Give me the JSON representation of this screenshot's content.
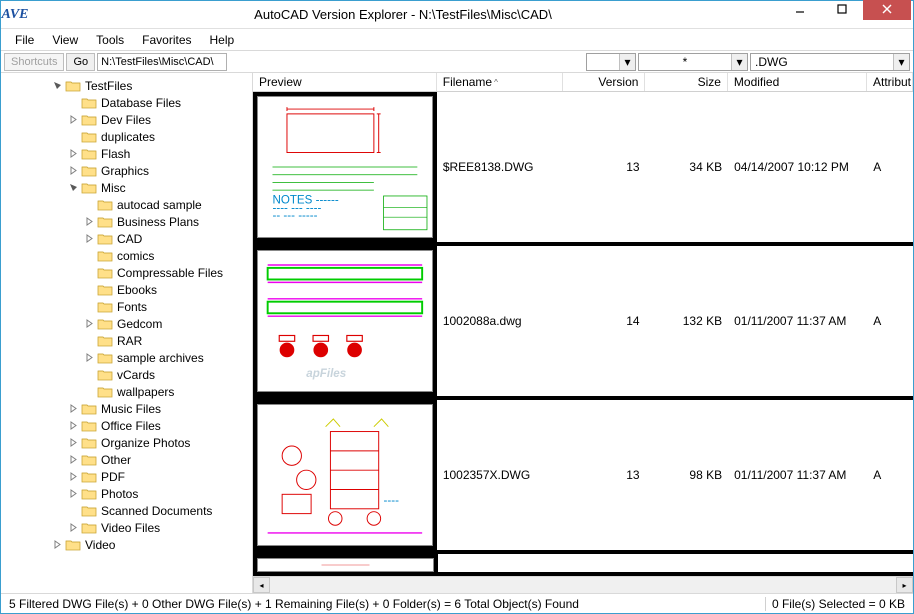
{
  "titlebar": {
    "logo_text": "AVE",
    "title": "AutoCAD Version Explorer - N:\\TestFiles\\Misc\\CAD\\"
  },
  "menu": [
    "File",
    "View",
    "Tools",
    "Favorites",
    "Help"
  ],
  "toolbar": {
    "shortcuts": "Shortcuts",
    "go": "Go",
    "path": "N:\\TestFiles\\Misc\\CAD\\",
    "filter1": "",
    "filter2": "*",
    "filter3": ".DWG"
  },
  "tree": [
    {
      "level": 3,
      "expand": "open",
      "label": "TestFiles"
    },
    {
      "level": 4,
      "expand": "none",
      "label": "Database Files"
    },
    {
      "level": 4,
      "expand": "closed",
      "label": "Dev Files"
    },
    {
      "level": 4,
      "expand": "none",
      "label": "duplicates"
    },
    {
      "level": 4,
      "expand": "closed",
      "label": "Flash"
    },
    {
      "level": 4,
      "expand": "closed",
      "label": "Graphics"
    },
    {
      "level": 4,
      "expand": "open",
      "label": "Misc"
    },
    {
      "level": 5,
      "expand": "none",
      "label": "autocad sample"
    },
    {
      "level": 5,
      "expand": "closed",
      "label": "Business Plans"
    },
    {
      "level": 5,
      "expand": "closed",
      "label": "CAD"
    },
    {
      "level": 5,
      "expand": "none",
      "label": "comics"
    },
    {
      "level": 5,
      "expand": "none",
      "label": "Compressable Files"
    },
    {
      "level": 5,
      "expand": "none",
      "label": "Ebooks"
    },
    {
      "level": 5,
      "expand": "none",
      "label": "Fonts"
    },
    {
      "level": 5,
      "expand": "closed",
      "label": "Gedcom"
    },
    {
      "level": 5,
      "expand": "none",
      "label": "RAR"
    },
    {
      "level": 5,
      "expand": "closed",
      "label": "sample archives"
    },
    {
      "level": 5,
      "expand": "none",
      "label": "vCards"
    },
    {
      "level": 5,
      "expand": "none",
      "label": "wallpapers"
    },
    {
      "level": 4,
      "expand": "closed",
      "label": "Music Files"
    },
    {
      "level": 4,
      "expand": "closed",
      "label": "Office Files"
    },
    {
      "level": 4,
      "expand": "closed",
      "label": "Organize Photos"
    },
    {
      "level": 4,
      "expand": "closed",
      "label": "Other"
    },
    {
      "level": 4,
      "expand": "closed",
      "label": "PDF"
    },
    {
      "level": 4,
      "expand": "closed",
      "label": "Photos"
    },
    {
      "level": 4,
      "expand": "none",
      "label": "Scanned Documents"
    },
    {
      "level": 4,
      "expand": "closed",
      "label": "Video Files"
    },
    {
      "level": 3,
      "expand": "closed",
      "label": "Video"
    }
  ],
  "columns": [
    {
      "label": "Preview",
      "width": 185,
      "align": "left"
    },
    {
      "label": "Filename",
      "width": 127,
      "align": "left",
      "sort": "^"
    },
    {
      "label": "Version",
      "width": 83,
      "align": "right"
    },
    {
      "label": "Size",
      "width": 83,
      "align": "right"
    },
    {
      "label": "Modified",
      "width": 140,
      "align": "left"
    },
    {
      "label": "Attribut",
      "width": 46,
      "align": "left"
    }
  ],
  "files": [
    {
      "filename": "$REE8138.DWG",
      "version": "13",
      "size": "34 KB",
      "modified": "04/14/2007 10:12 PM",
      "attr": "A",
      "preview": "cad1"
    },
    {
      "filename": "1002088a.dwg",
      "version": "14",
      "size": "132 KB",
      "modified": "01/11/2007 11:37 AM",
      "attr": "A",
      "preview": "cad2"
    },
    {
      "filename": "1002357X.DWG",
      "version": "13",
      "size": "98 KB",
      "modified": "01/11/2007 11:37 AM",
      "attr": "A",
      "preview": "cad3"
    }
  ],
  "status": {
    "left": "5 Filtered DWG File(s) + 0 Other DWG File(s) + 1 Remaining File(s) + 0 Folder(s)  =  6 Total Object(s) Found",
    "right": "0 File(s) Selected = 0 KB"
  }
}
